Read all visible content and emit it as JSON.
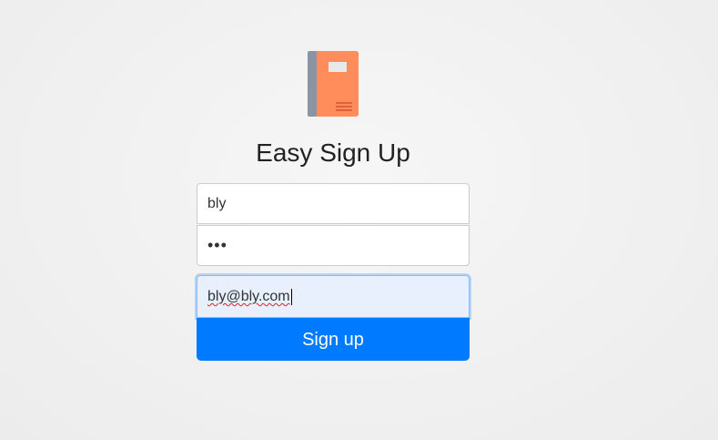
{
  "app": {
    "title": "Easy Sign Up",
    "logo_icon": "notebook-icon"
  },
  "form": {
    "username_value": "bly",
    "password_masked": "•••",
    "email_value": "bly@bly.com",
    "submit_label": "Sign up"
  },
  "colors": {
    "accent": "#007bff",
    "book_cover": "#ff8c5a",
    "book_spine": "#8a95a3",
    "email_focus_bg": "#e8f0fd"
  }
}
